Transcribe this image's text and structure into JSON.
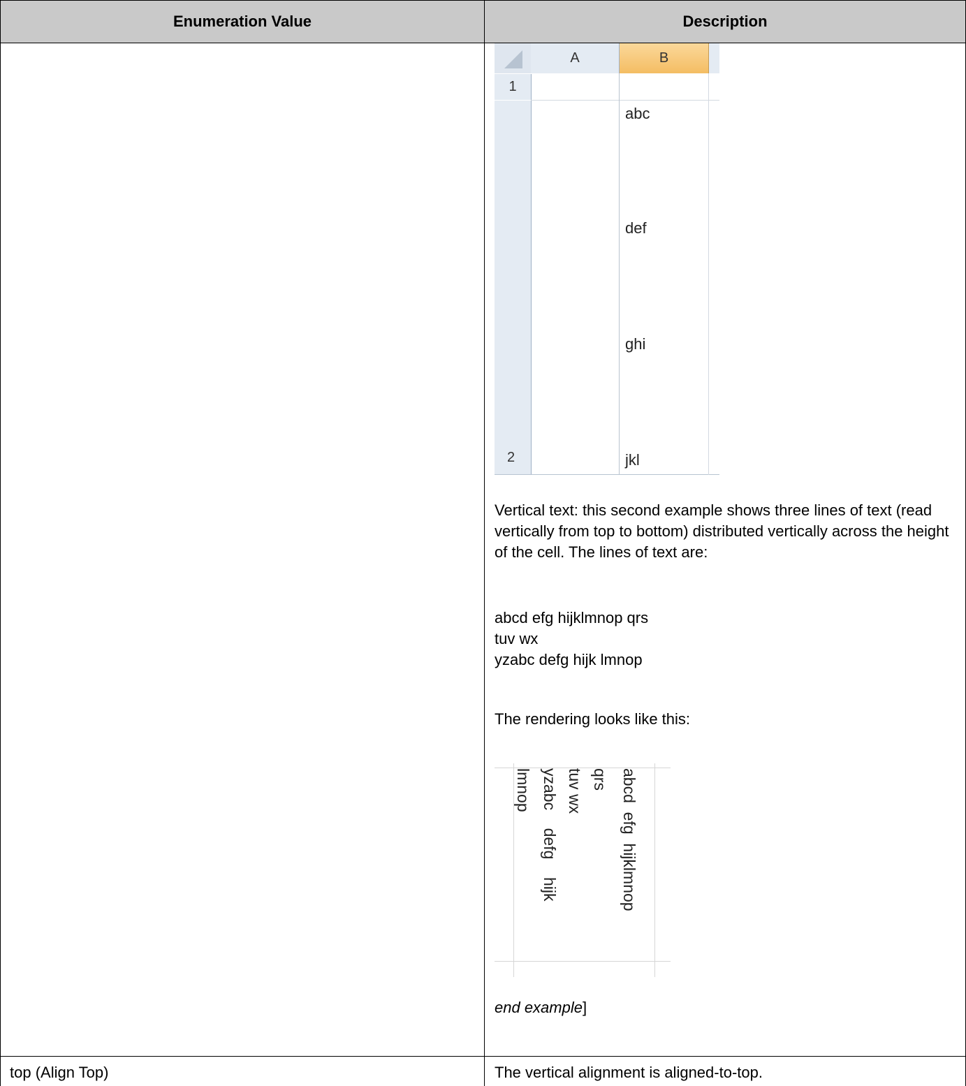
{
  "table": {
    "headers": [
      "Enumeration Value",
      "Description"
    ],
    "rows": [
      {
        "value": "",
        "description_paragraphs": [
          "Vertical text: this second example shows three lines of text (read vertically from top to bottom) distributed vertically across the height of the cell. The lines of text are:",
          "abcd efg hijklmnop qrs",
          "tuv wx",
          "yzabc defg hijk lmnop",
          "The rendering looks like this:"
        ],
        "end_example_italic": "end example",
        "end_example_bracket": "]"
      },
      {
        "value": "top (Align Top)",
        "description": "The vertical alignment is aligned-to-top."
      }
    ]
  },
  "spreadsheet_example": {
    "columns": [
      "A",
      "B"
    ],
    "rows": [
      "1",
      "2"
    ],
    "cell_lines": [
      "abc",
      "def",
      "ghi",
      "jkl"
    ]
  },
  "vertical_rendering": {
    "columns": [
      "abcd  efg  hijklmnop",
      "qrs",
      "tuv wx",
      "yzabc    defg    hijk",
      "lmnop"
    ]
  }
}
